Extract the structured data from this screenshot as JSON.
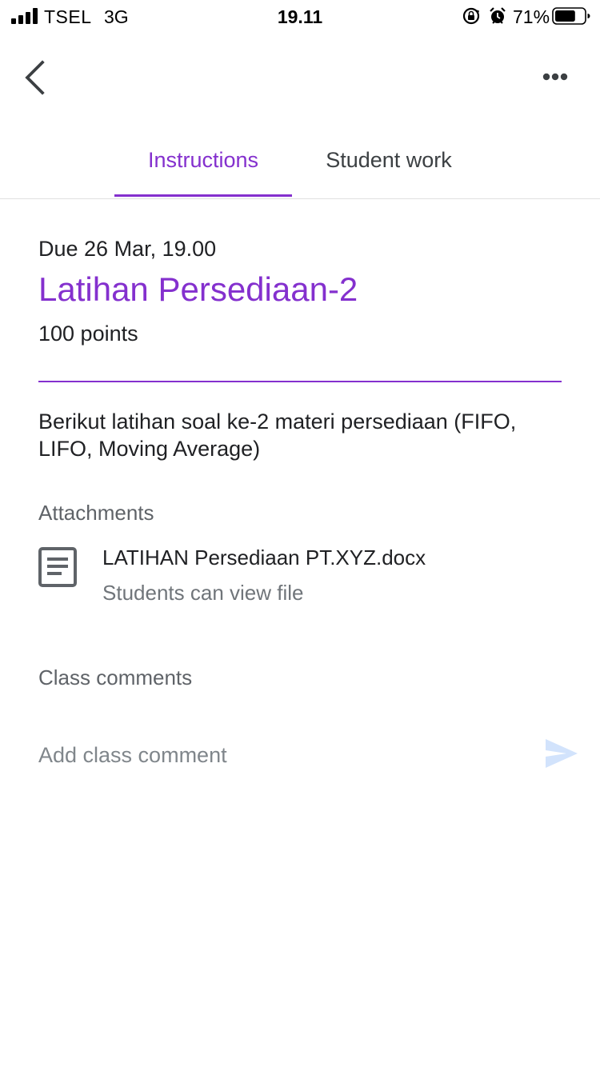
{
  "status_bar": {
    "carrier": "TSEL",
    "network": "3G",
    "time": "19.11",
    "battery_percent": "71%",
    "battery_level": 0.71,
    "icons": [
      "signal-icon",
      "rotation-lock-icon",
      "alarm-icon",
      "battery-icon"
    ]
  },
  "app_bar": {
    "back_icon": "chevron-left-icon",
    "more_icon": "more-horizontal-icon"
  },
  "tabs": [
    {
      "label": "Instructions",
      "active": true
    },
    {
      "label": "Student work",
      "active": false
    }
  ],
  "assignment": {
    "due": "Due 26 Mar, 19.00",
    "title": "Latihan Persediaan-2",
    "points": "100 points",
    "description": "Berikut latihan soal ke-2 materi persediaan (FIFO, LIFO, Moving Average)"
  },
  "attachments": {
    "label": "Attachments",
    "items": [
      {
        "icon": "document-icon",
        "name": "LATIHAN Persediaan PT.XYZ.docx",
        "permission": "Students can view file"
      }
    ]
  },
  "comments": {
    "label": "Class comments",
    "placeholder": "Add class comment",
    "send_icon": "send-icon"
  },
  "colors": {
    "accent": "#8430ce",
    "text": "#202124",
    "secondary_text": "#5f6368",
    "send_disabled": "#d2e3fc"
  }
}
